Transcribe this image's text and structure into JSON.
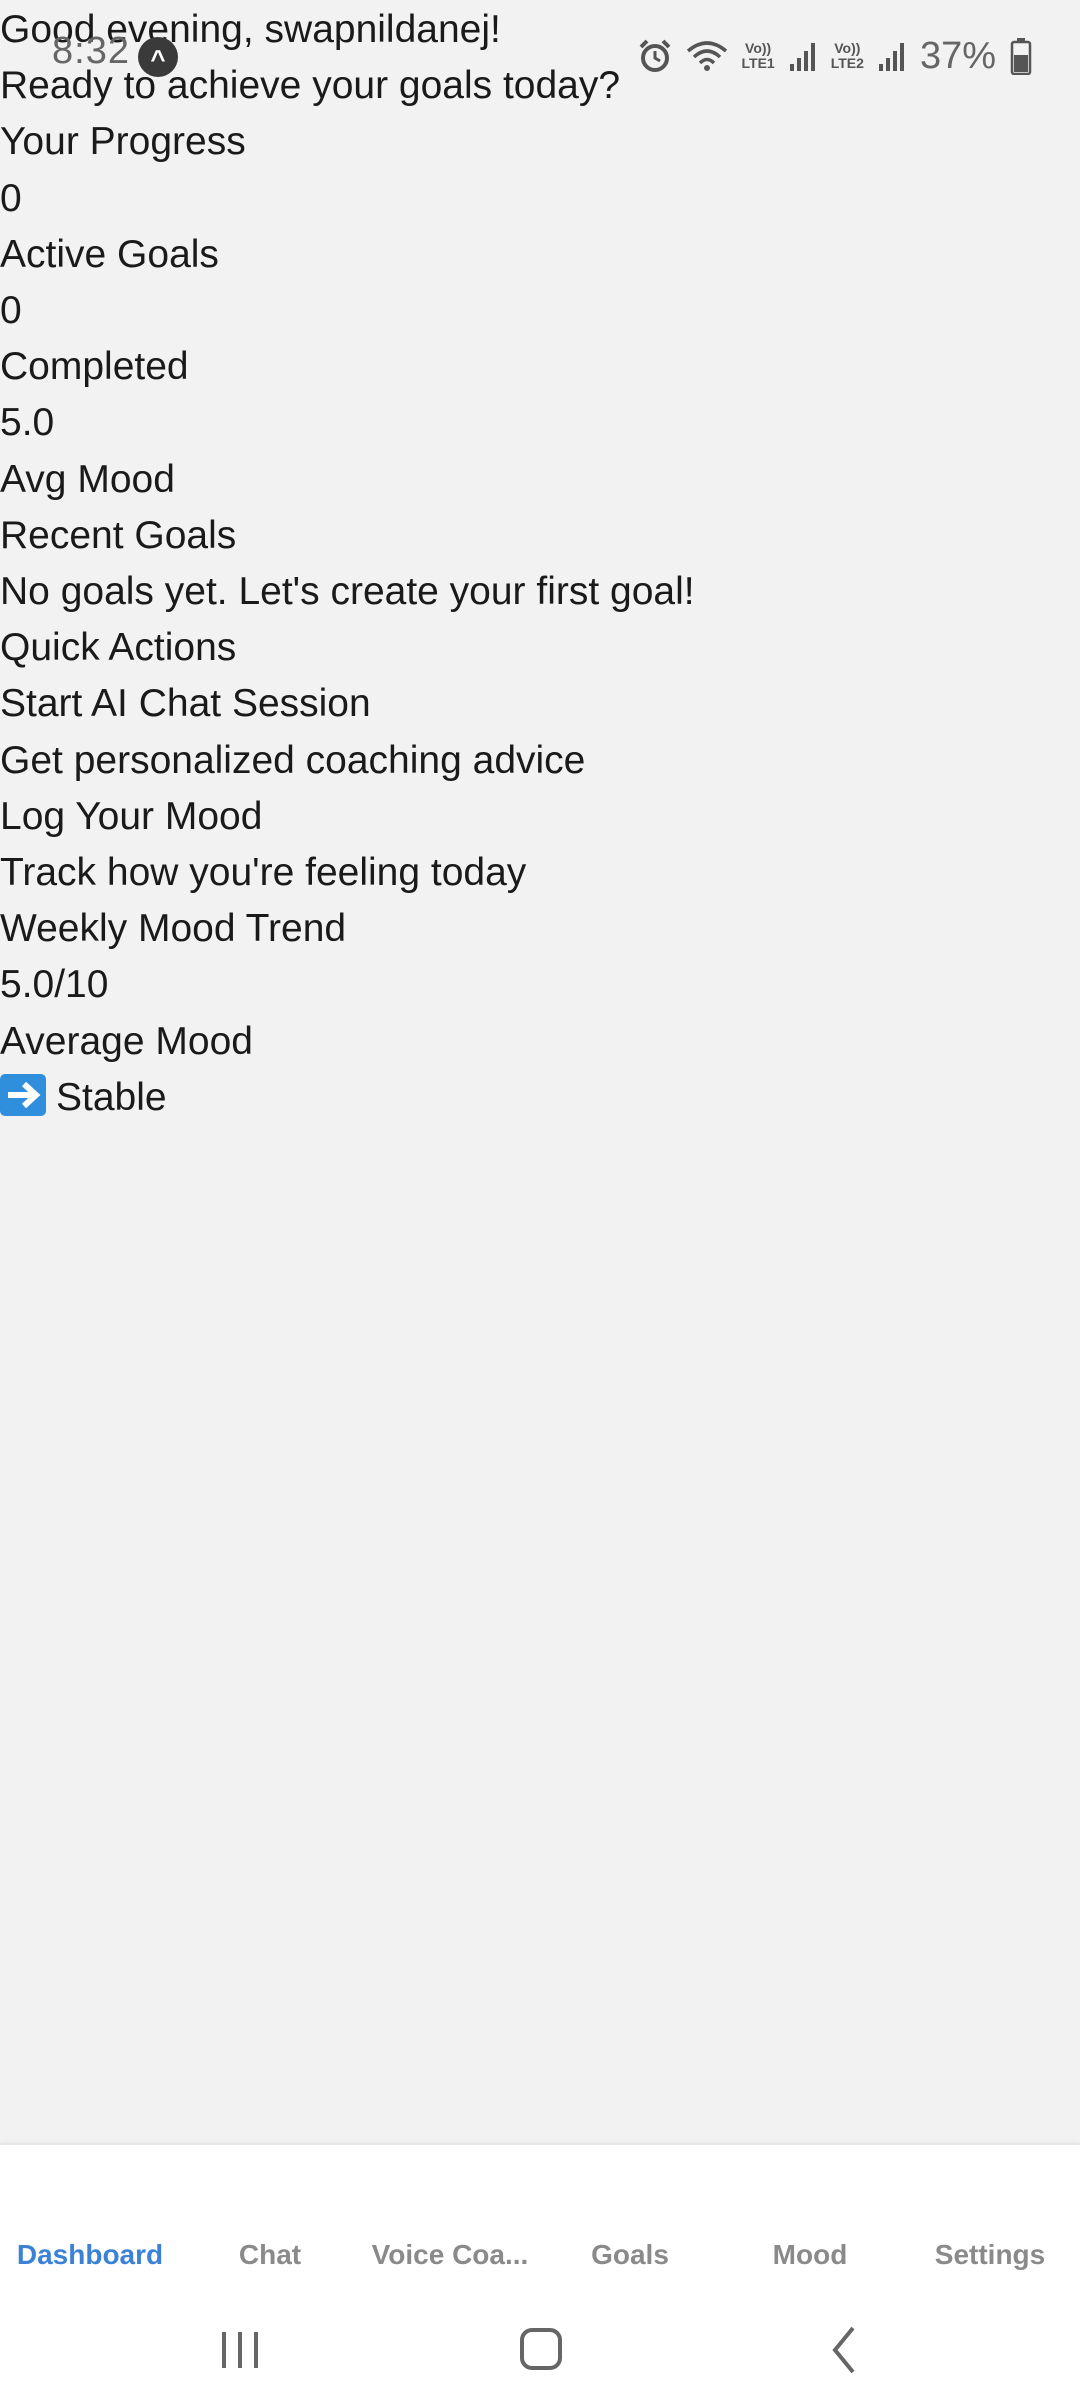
{
  "status_bar": {
    "time": "8:32",
    "app_icon_glyph": "^",
    "lte1_label": "LTE1",
    "lte2_label": "LTE2",
    "volte_label": "Vo))",
    "battery": "37%",
    "icons": [
      "alarm-icon",
      "wifi-icon",
      "signal-icon",
      "signal-icon",
      "battery-icon"
    ]
  },
  "dashboard": {
    "greeting": "Good evening, swapnildanej!",
    "subtitle": "Ready to achieve your goals today?",
    "progress_heading": "Your Progress",
    "active_goals_value": "0",
    "active_goals_label": "Active Goals",
    "completed_value": "0",
    "completed_label": "Completed",
    "avg_mood_value": "5.0",
    "avg_mood_label": "Avg Mood",
    "recent_goals_heading": "Recent Goals",
    "no_goals_text": "No goals yet. Let's create your first goal!",
    "quick_actions_heading": "Quick Actions",
    "chat_action_title": "Start AI Chat Session",
    "chat_action_desc": "Get personalized coaching advice",
    "mood_action_title": "Log Your Mood",
    "mood_action_desc": "Track how you're feeling today",
    "weekly_trend_heading": "Weekly Mood Trend",
    "weekly_avg_value": "5.0/10",
    "weekly_avg_label": "Average Mood",
    "trend_text": "Stable",
    "trend_icon": "right-arrow-icon"
  },
  "tabs": [
    {
      "label": "Dashboard",
      "active": true
    },
    {
      "label": "Chat",
      "active": false
    },
    {
      "label": "Voice Coa...",
      "active": false
    },
    {
      "label": "Goals",
      "active": false
    },
    {
      "label": "Mood",
      "active": false
    },
    {
      "label": "Settings",
      "active": false
    }
  ],
  "colors": {
    "background": "#f2f2f2",
    "text": "#1a1a1a",
    "tab_active": "#3b82d6",
    "tab_inactive": "#8a8a8a",
    "trend_icon_bg": "#2f8fdc"
  }
}
